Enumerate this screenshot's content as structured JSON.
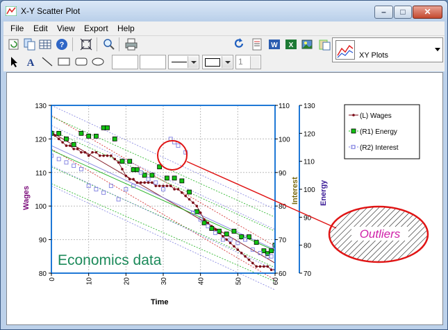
{
  "window": {
    "title": "X-Y Scatter Plot"
  },
  "menu": [
    "File",
    "Edit",
    "View",
    "Export",
    "Help"
  ],
  "toolbar": {
    "spin_value": "1",
    "plot_type_selected": "XY Plots"
  },
  "colors": {
    "wages": "#7a0a16",
    "energy": "#12c212",
    "interest": "#7d7de0",
    "axis_blue": "#1f78d6",
    "accent_red": "#e01414"
  },
  "icons": [
    "refresh-icon",
    "copy-icon",
    "table-icon",
    "help-icon",
    "fit-icon",
    "zoom-icon",
    "print-icon",
    "redo-icon",
    "doc-icon",
    "word-icon",
    "excel-icon",
    "image-icon",
    "clipboard-icon",
    "arrow-tool-icon",
    "text-tool-icon",
    "line-tool-icon",
    "rect-tool-icon",
    "rounded-rect-tool-icon",
    "ellipse-tool-icon"
  ],
  "chart_data": {
    "type": "scatter",
    "xlabel": "Time",
    "xlim": [
      0,
      60
    ],
    "xticks": [
      "0",
      "10",
      "20",
      "30",
      "40",
      "50",
      "60"
    ],
    "left_axis": {
      "label": "Wages",
      "range": [
        80,
        130
      ],
      "ticks": [
        "80",
        "90",
        "100",
        "110",
        "120",
        "130"
      ]
    },
    "right1_axis": {
      "label": "Interest",
      "range": [
        60,
        110
      ],
      "ticks": [
        "60",
        "70",
        "80",
        "90",
        "100",
        "110"
      ]
    },
    "right2_axis": {
      "label": "Energy",
      "range": [
        70,
        130
      ],
      "ticks": [
        "70",
        "80",
        "90",
        "100",
        "110",
        "120",
        "130"
      ]
    },
    "grid": true,
    "legend_position": "top-right",
    "legend": [
      "(L) Wages",
      "(R1) Energy",
      "(R2) Interest"
    ],
    "annotations": {
      "text": "Economics data",
      "callout": "Outliers"
    },
    "series": [
      {
        "name": "(L) Wages",
        "axis": "left",
        "x": [
          0,
          1,
          2,
          3,
          4,
          5,
          6,
          7,
          8,
          9,
          10,
          11,
          12,
          13,
          14,
          15,
          16,
          17,
          18,
          19,
          20,
          21,
          22,
          23,
          24,
          25,
          26,
          27,
          28,
          29,
          30,
          31,
          32,
          33,
          34,
          35,
          36,
          37,
          38,
          39,
          40,
          41,
          42,
          43,
          44,
          45,
          46,
          47,
          48,
          49,
          50,
          51,
          52,
          53,
          54,
          55,
          56,
          57,
          58,
          59,
          60
        ],
        "y": [
          122,
          121,
          120,
          119,
          118,
          118,
          117,
          117,
          116,
          116,
          115,
          116,
          116,
          115,
          115,
          115,
          115,
          114,
          113,
          111,
          109,
          108,
          108,
          107,
          107,
          107,
          107,
          107,
          106,
          106,
          106,
          106,
          106,
          105,
          105,
          104,
          103,
          102,
          101,
          100,
          98,
          96,
          95,
          94,
          93,
          92,
          91,
          90,
          89,
          88,
          87,
          86,
          85,
          84,
          83,
          82,
          82,
          82,
          82,
          81,
          81
        ]
      },
      {
        "name": "(R1) Energy",
        "axis": "right2",
        "x": [
          0,
          2,
          4,
          6,
          8,
          10,
          12,
          14,
          15,
          17,
          19,
          21,
          22,
          23,
          25,
          27,
          29,
          31,
          33,
          35,
          37,
          39,
          41,
          43,
          45,
          47,
          49,
          51,
          53,
          55,
          57,
          58,
          59,
          60
        ],
        "y": [
          120,
          120,
          118,
          116,
          120,
          119,
          119,
          122,
          122,
          118,
          110,
          110,
          107,
          107,
          105,
          105,
          108,
          104,
          104,
          103,
          99,
          92,
          88,
          86,
          85,
          84,
          85,
          83,
          83,
          81,
          78,
          77,
          78,
          80
        ]
      },
      {
        "name": "(R2) Interest",
        "axis": "right1",
        "x": [
          0,
          2,
          4,
          6,
          8,
          10,
          12,
          14,
          16,
          18,
          20,
          22,
          24,
          26,
          28,
          30,
          32,
          33,
          34,
          36,
          38,
          40,
          42,
          44,
          46,
          48,
          50,
          52,
          54,
          56,
          58,
          59,
          60
        ],
        "y": [
          95,
          94,
          93,
          92,
          91,
          86,
          85,
          84,
          86,
          82,
          85,
          86,
          90,
          88,
          87,
          85,
          100,
          99,
          98,
          96,
          78,
          76,
          74,
          72,
          70,
          70,
          69,
          70,
          67,
          66,
          65,
          65,
          68
        ]
      }
    ],
    "bands": {
      "wages": [
        [
          122,
          83
        ],
        [
          127,
          88
        ],
        [
          117,
          78
        ]
      ],
      "energy": [
        [
          114,
          78
        ],
        [
          121,
          85
        ],
        [
          108,
          72
        ],
        [
          126,
          90
        ],
        [
          102,
          67
        ]
      ],
      "interest": [
        [
          98,
          67
        ],
        [
          104,
          73
        ],
        [
          92,
          61
        ],
        [
          110,
          79
        ],
        [
          86,
          55
        ]
      ]
    }
  }
}
